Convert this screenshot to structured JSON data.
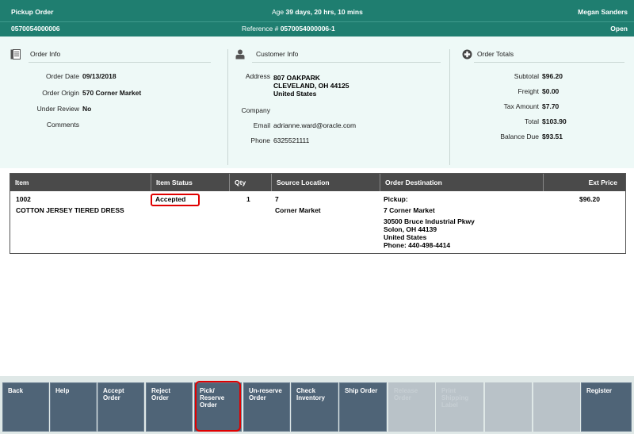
{
  "header": {
    "title": "Pickup Order",
    "order_number": "0570054000006",
    "age_label": "Age",
    "age_value": "39 days, 20 hrs, 10 mins",
    "reference_label": "Reference #",
    "reference_value": "0570054000006-1",
    "user": "Megan Sanders",
    "status": "Open"
  },
  "order_info": {
    "title": "Order Info",
    "fields": [
      {
        "label": "Order Date",
        "value": "09/13/2018"
      },
      {
        "label": "Order Origin",
        "value": "570 Corner Market"
      },
      {
        "label": "Under Review",
        "value": "No"
      },
      {
        "label": "Comments",
        "value": ""
      }
    ]
  },
  "customer_info": {
    "title": "Customer Info",
    "address_label": "Address",
    "address_lines": [
      "807 OAKPARK",
      "CLEVELAND, OH 44125",
      "United States"
    ],
    "company_label": "Company",
    "company_value": "",
    "email_label": "Email",
    "email_value": "adrianne.ward@oracle.com",
    "phone_label": "Phone",
    "phone_value": "6325521111"
  },
  "order_totals": {
    "title": "Order Totals",
    "fields": [
      {
        "label": "Subtotal",
        "value": "$96.20"
      },
      {
        "label": "Freight",
        "value": "$0.00"
      },
      {
        "label": "Tax Amount",
        "value": "$7.70"
      },
      {
        "label": "Total",
        "value": "$103.90"
      },
      {
        "label": "Balance Due",
        "value": "$93.51"
      }
    ]
  },
  "table": {
    "columns": [
      "Item",
      "Item Status",
      "Qty",
      "Source Location",
      "Order Destination",
      "Ext Price"
    ],
    "rows": [
      {
        "item_number": "1002",
        "item_description": "COTTON JERSEY TIERED DRESS",
        "status": "Accepted",
        "qty": "1",
        "source_number": "7",
        "source_name": "Corner Market",
        "destination_lines": [
          "Pickup:",
          "7 Corner Market"
        ],
        "destination_address": [
          "30500 Bruce Industrial Pkwy",
          "Solon, OH 44139",
          "United States",
          "Phone: 440-498-4414"
        ],
        "ext_price": "$96.20"
      }
    ]
  },
  "toolbar": {
    "buttons": [
      {
        "lines": [
          "Back"
        ],
        "enabled": true
      },
      {
        "lines": [
          "Help"
        ],
        "enabled": true
      },
      {
        "lines": [
          "Accept",
          "Order"
        ],
        "enabled": true
      },
      {
        "lines": [
          "Reject",
          "Order"
        ],
        "enabled": true
      },
      {
        "lines": [
          "Pick/",
          "Reserve",
          "Order"
        ],
        "enabled": true
      },
      {
        "lines": [
          "Un-reserve",
          "Order"
        ],
        "enabled": true
      },
      {
        "lines": [
          "Check",
          "Inventory"
        ],
        "enabled": true
      },
      {
        "lines": [
          "Ship Order"
        ],
        "enabled": true
      },
      {
        "lines": [
          "Release",
          "Order"
        ],
        "enabled": false
      },
      {
        "lines": [
          "Print",
          "Shipping",
          "Label"
        ],
        "enabled": false
      },
      {
        "lines": [
          ""
        ],
        "enabled": false
      },
      {
        "lines": [
          ""
        ],
        "enabled": false
      },
      {
        "lines": [
          "Register"
        ],
        "enabled": true
      }
    ]
  },
  "colors": {
    "header_bg": "#1f7e70",
    "panel_bg": "#eef9f7",
    "button_bg": "#4f6477",
    "button_disabled": "#b9c2c8",
    "highlight": "#e00000"
  }
}
